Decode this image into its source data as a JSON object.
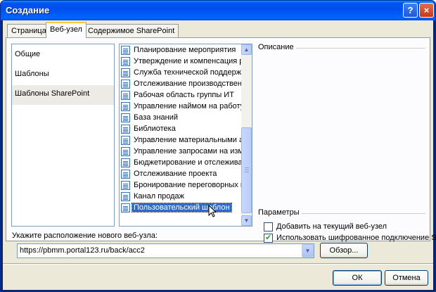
{
  "window": {
    "title": "Создание",
    "help_label": "?",
    "close_label": "×"
  },
  "tabs": [
    {
      "label": "Страница",
      "active": false
    },
    {
      "label": "Веб-узел",
      "active": true
    },
    {
      "label": "Содержимое SharePoint",
      "active": false
    }
  ],
  "categories": [
    {
      "label": "Общие",
      "selected": false
    },
    {
      "label": "Шаблоны",
      "selected": false
    },
    {
      "label": "Шаблоны SharePoint",
      "selected": true
    }
  ],
  "templates": [
    {
      "label": "Планирование мероприятия"
    },
    {
      "label": "Утверждение и компенсация рас"
    },
    {
      "label": "Служба технической поддержки"
    },
    {
      "label": "Отслеживание производственны"
    },
    {
      "label": "Рабочая область группы ИТ"
    },
    {
      "label": "Управление наймом на работу"
    },
    {
      "label": "База знаний"
    },
    {
      "label": "Библиотека"
    },
    {
      "label": "Управление материальными акти"
    },
    {
      "label": "Управление запросами на измене"
    },
    {
      "label": "Бюджетирование и отслеживани"
    },
    {
      "label": "Отслеживание проекта"
    },
    {
      "label": "Бронирование переговорных и об"
    },
    {
      "label": "Канал продаж"
    },
    {
      "label": "Пользовательский шаблон",
      "selected": true
    }
  ],
  "scrollbar": {
    "up_glyph": "▲",
    "down_glyph": "▼"
  },
  "description": {
    "label": "Описание"
  },
  "parameters": {
    "label": "Параметры",
    "options": [
      {
        "label": "Добавить на текущий веб-узел",
        "checked": false
      },
      {
        "label": "Использовать шифрованное подключение SSL",
        "checked": true
      }
    ],
    "check_glyph": "✔"
  },
  "location": {
    "label": "Укажите расположение нового веб-узла:",
    "value": "https://pbmm.portal123.ru/back/acc2",
    "dropdown_glyph": "▼",
    "browse_label": "Обзор..."
  },
  "footer": {
    "ok_label": "ОК",
    "cancel_label": "Отмена"
  },
  "colors": {
    "titlebar": "#0054e3",
    "selection": "#316ac5",
    "tab_highlight": "#ffc83c",
    "dialog_bg": "#ece9d8",
    "check": "#21a121"
  }
}
